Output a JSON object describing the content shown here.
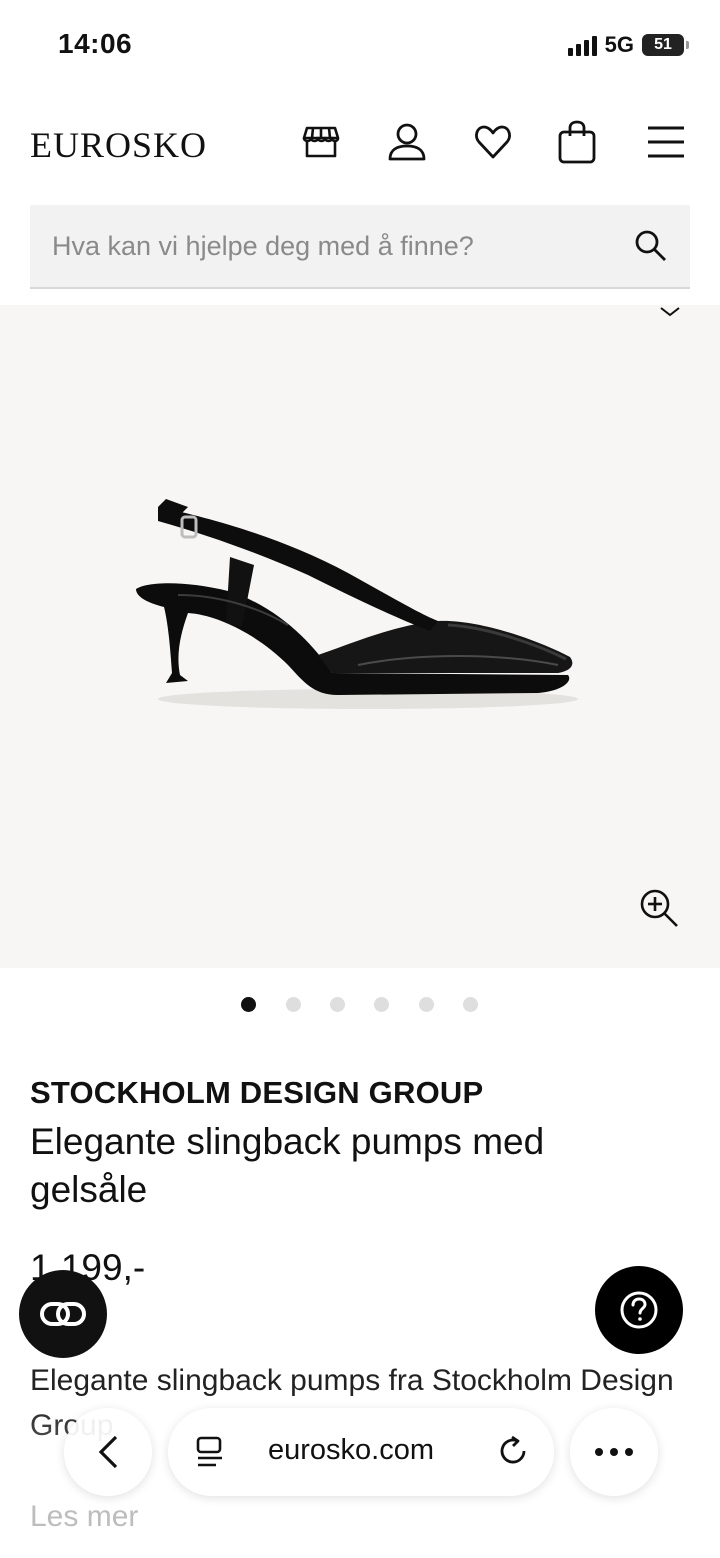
{
  "status_bar": {
    "time": "14:06",
    "network": "5G",
    "battery": "51"
  },
  "header": {
    "logo": "EUROSKO",
    "icons": [
      "store-icon",
      "user-icon",
      "heart-icon",
      "bag-icon",
      "menu-icon"
    ]
  },
  "search": {
    "placeholder": "Hva kan vi hjelpe deg med å finne?"
  },
  "gallery": {
    "image_count": 6,
    "active_index": 0
  },
  "product": {
    "brand": "STOCKHOLM DESIGN GROUP",
    "title": "Elegante slingback pumps med gelsåle",
    "price": "1.199,-",
    "description": "Elegante slingback pumps fra Stockholm Design Group",
    "read_more": "Les mer"
  },
  "browser": {
    "url": "eurosko.com"
  },
  "colors": {
    "accent": "#111111",
    "gallery_bg": "#f7f6f4",
    "search_bg": "#f2f2f2"
  }
}
